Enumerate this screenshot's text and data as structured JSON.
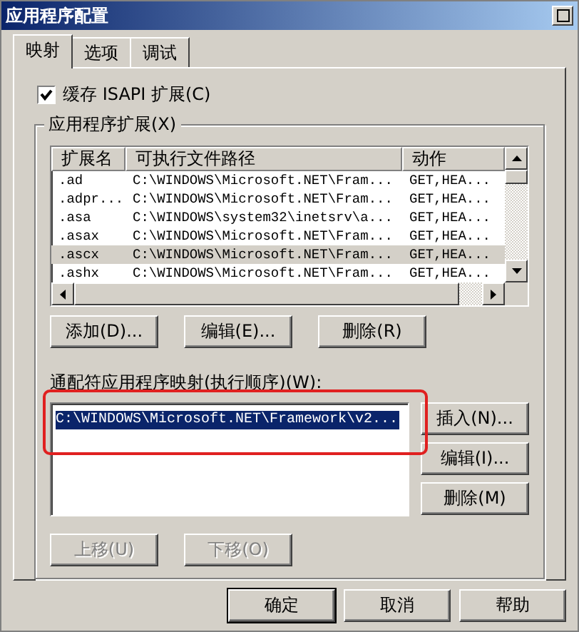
{
  "window": {
    "title": "应用程序配置"
  },
  "tabs": [
    {
      "label": "映射",
      "selected": true
    },
    {
      "label": "选项",
      "selected": false
    },
    {
      "label": "调试",
      "selected": false
    }
  ],
  "cache_isapi": {
    "label": "缓存 ISAPI 扩展(C)",
    "checked": true
  },
  "extensions": {
    "title": "应用程序扩展(X)",
    "columns": [
      "扩展名",
      "可执行文件路径",
      "动作"
    ],
    "rows": [
      {
        "cells": [
          ".ad",
          "C:\\WINDOWS\\Microsoft.NET\\Fram...",
          "GET,HEA..."
        ],
        "selected": false
      },
      {
        "cells": [
          ".adpr...",
          "C:\\WINDOWS\\Microsoft.NET\\Fram...",
          "GET,HEA..."
        ],
        "selected": false
      },
      {
        "cells": [
          ".asa",
          "C:\\WINDOWS\\system32\\inetsrv\\a...",
          "GET,HEA..."
        ],
        "selected": false
      },
      {
        "cells": [
          ".asax",
          "C:\\WINDOWS\\Microsoft.NET\\Fram...",
          "GET,HEA..."
        ],
        "selected": false
      },
      {
        "cells": [
          ".ascx",
          "C:\\WINDOWS\\Microsoft.NET\\Fram...",
          "GET,HEA..."
        ],
        "selected": true
      },
      {
        "cells": [
          ".ashx",
          "C:\\WINDOWS\\Microsoft.NET\\Fram...",
          "GET,HEA..."
        ],
        "selected": false
      }
    ],
    "buttons": [
      "添加(D)...",
      "编辑(E)...",
      "删除(R)"
    ]
  },
  "wildcard": {
    "label": "通配符应用程序映射(执行顺序)(W):",
    "items": [
      {
        "text": "C:\\WINDOWS\\Microsoft.NET\\Framework\\v2...",
        "selected": true
      }
    ],
    "side_buttons": [
      "插入(N)...",
      "编辑(I)...",
      "删除(M)"
    ],
    "move_buttons": [
      {
        "label": "上移(U)",
        "disabled": true
      },
      {
        "label": "下移(O)",
        "disabled": true
      }
    ]
  },
  "buttons": [
    "确定",
    "取消",
    "帮助"
  ]
}
